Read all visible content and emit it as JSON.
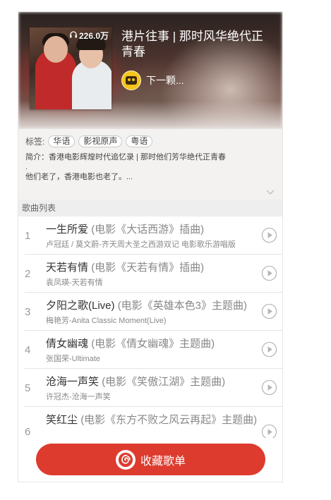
{
  "header": {
    "play_count": "226.0万",
    "title": "港片往事 | 那时风华绝代正青春",
    "creator_name": "下一颗..."
  },
  "info": {
    "tags_label": "标签:",
    "tags": [
      "华语",
      "影视原声",
      "粤语"
    ],
    "description": "简介：香港电影辉煌时代追忆录 | 那时他们芳华绝代正青春\n.\n他们老了，香港电影也老了。..."
  },
  "song_list": {
    "title": "歌曲列表",
    "songs": [
      {
        "index": "1",
        "name": "一生所爱",
        "sub": "(电影《大话西游》插曲)",
        "artist": "卢冠廷 / 莫文蔚-齐天周大圣之西游双记 电影歌乐游唱版"
      },
      {
        "index": "2",
        "name": "天若有情",
        "sub": "(电影《天若有情》插曲)",
        "artist": "袁凤瑛-天若有情"
      },
      {
        "index": "3",
        "name": "夕阳之歌(Live)",
        "sub": "(电影《英雄本色3》主题曲)",
        "artist": "梅艳芳-Anita Classic Moment(Live)"
      },
      {
        "index": "4",
        "name": "倩女幽魂",
        "sub": "(电影《倩女幽魂》主题曲)",
        "artist": "张国荣-Ultimate"
      },
      {
        "index": "5",
        "name": "沧海一声笑",
        "sub": "(电影《笑傲江湖》主题曲)",
        "artist": "许冠杰-沧海一声笑"
      },
      {
        "index": "6",
        "name": "笑红尘",
        "sub": "(电影《东方不败之风云再起》主题曲)",
        "artist": ""
      }
    ]
  },
  "bottom": {
    "collect_label": "收藏歌单"
  },
  "colors": {
    "accent": "#dd3b2e",
    "avatar": "#f3c51a"
  }
}
